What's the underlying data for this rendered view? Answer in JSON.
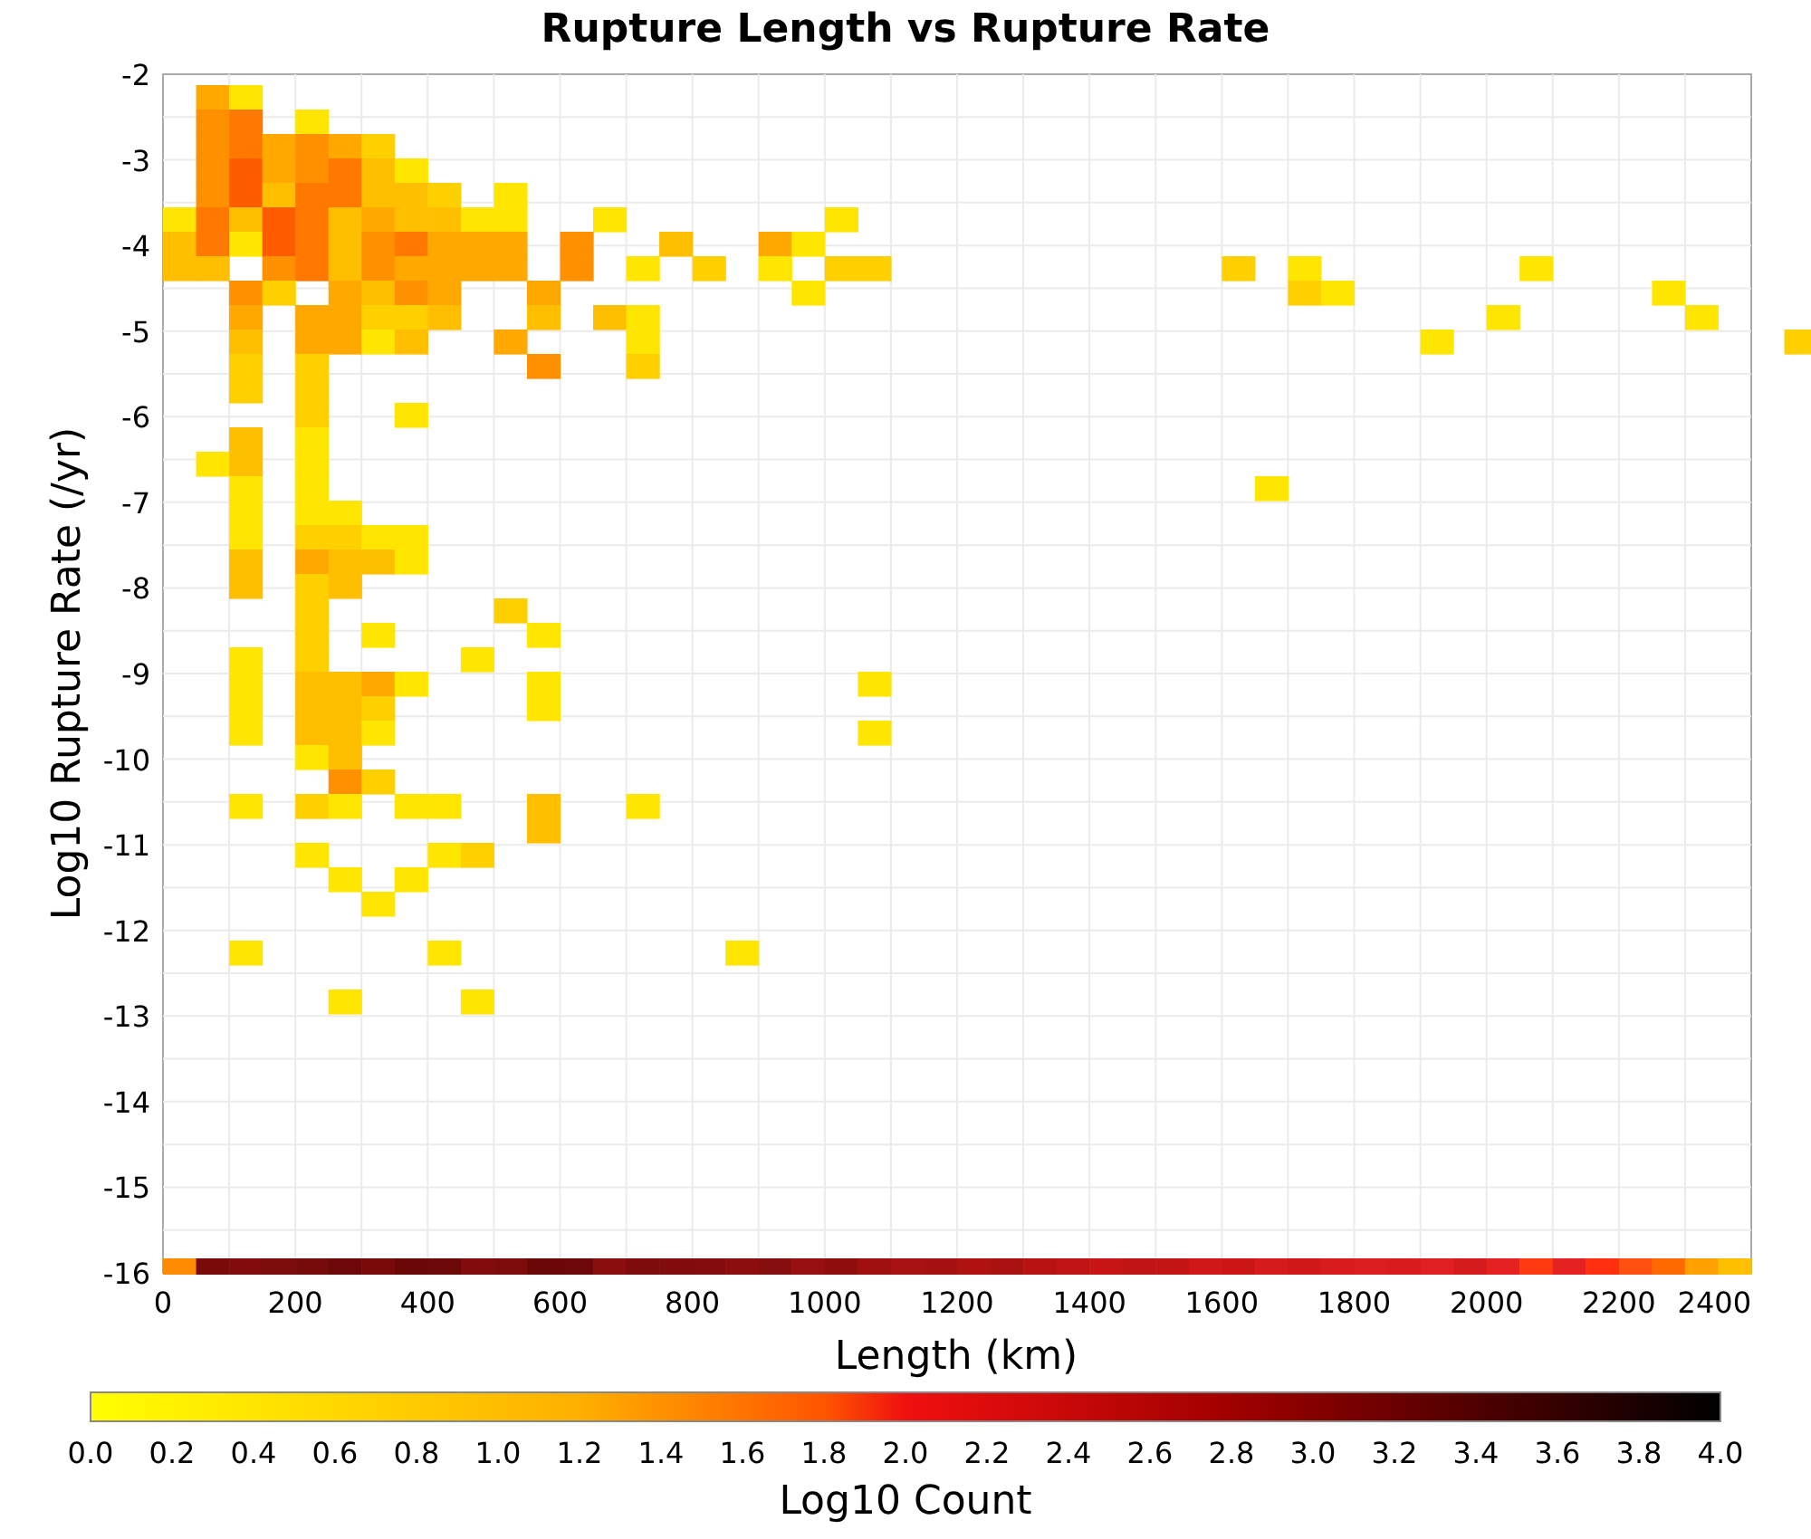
{
  "chart": {
    "title": "Rupture Length vs Rupture Rate",
    "xlabel": "Length (km)",
    "ylabel": "Log10 Rupture Rate (/yr)",
    "xticks": [
      "0",
      "200",
      "400",
      "600",
      "800",
      "1000",
      "1200",
      "1400",
      "1600",
      "1800",
      "2000",
      "2200",
      "2400"
    ],
    "yticks": [
      "-2",
      "-3",
      "-4",
      "-5",
      "-6",
      "-7",
      "-8",
      "-9",
      "-10",
      "-11",
      "-12",
      "-13",
      "-14",
      "-15",
      "-16"
    ]
  },
  "colorbar": {
    "label": "Log10 Count",
    "ticks": [
      "0.0",
      "0.2",
      "0.4",
      "0.6",
      "0.8",
      "1.0",
      "1.2",
      "1.4",
      "1.6",
      "1.8",
      "2.0",
      "2.2",
      "2.4",
      "2.6",
      "2.8",
      "3.0",
      "3.2",
      "3.4",
      "3.6",
      "3.8",
      "4.0"
    ]
  }
}
